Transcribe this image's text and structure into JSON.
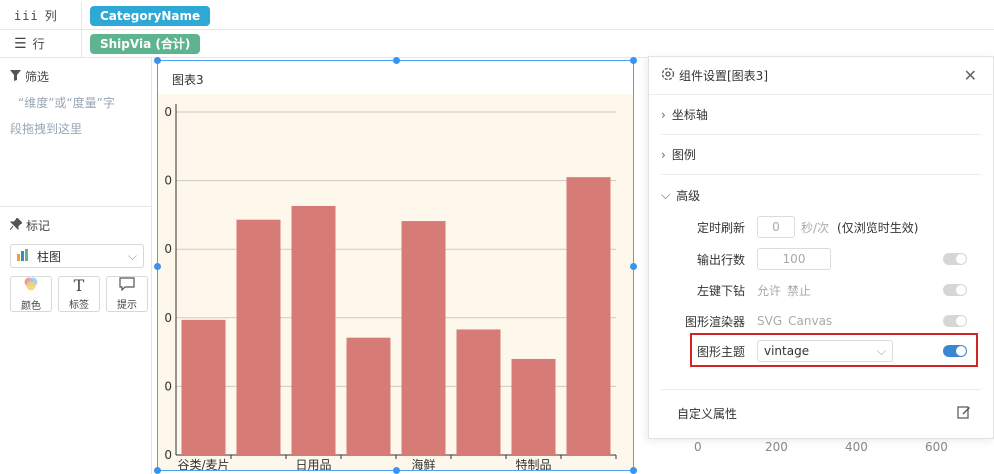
{
  "shelves": {
    "columns": {
      "label": "列",
      "pill": "CategoryName",
      "pill_color": "#2ea8d4"
    },
    "rows": {
      "label": "行",
      "pill": "ShipVia (合计)",
      "pill_color": "#5fb490"
    }
  },
  "filter": {
    "title": "筛选",
    "hint_line1": "“维度”或“度量”字",
    "hint_line2": "段拖拽到这里"
  },
  "marks": {
    "title": "标记",
    "chart_type": "柱图",
    "buttons": [
      "颜色",
      "标签",
      "提示"
    ]
  },
  "chart": {
    "title": "图表3",
    "y_tick_labels": [
      "0",
      "0",
      "0",
      "0",
      "0",
      "0"
    ],
    "x_labels": [
      "谷类/麦片",
      "日用品",
      "海鲜",
      "特制品"
    ],
    "bar_color": "#d77b77",
    "background": "#fef7ec"
  },
  "chart_data": {
    "type": "bar",
    "title": "图表3",
    "categories": [
      "谷类/麦片",
      "",
      "日用品",
      "",
      "海鲜",
      "",
      "特制品",
      ""
    ],
    "values": [
      197,
      343,
      363,
      171,
      341,
      183,
      140,
      405
    ],
    "ylim": [
      0,
      500
    ]
  },
  "settings": {
    "title": "组件设置[图表3]",
    "sections": {
      "axis": "坐标轴",
      "legend": "图例",
      "advanced": "高级"
    },
    "refresh": {
      "label": "定时刷新",
      "value": "0",
      "unit": "秒/次",
      "note": "(仅浏览时生效)"
    },
    "output_rows": {
      "label": "输出行数",
      "value": "100"
    },
    "drill": {
      "label": "左键下钻",
      "opt1": "允许",
      "opt2": "禁止"
    },
    "renderer": {
      "label": "图形渲染器",
      "opt1": "SVG",
      "opt2": "Canvas"
    },
    "theme": {
      "label": "图形主题",
      "value": "vintage"
    },
    "custom": {
      "label": "自定义属性"
    }
  },
  "background_axis": [
    "0",
    "200",
    "400",
    "600"
  ]
}
